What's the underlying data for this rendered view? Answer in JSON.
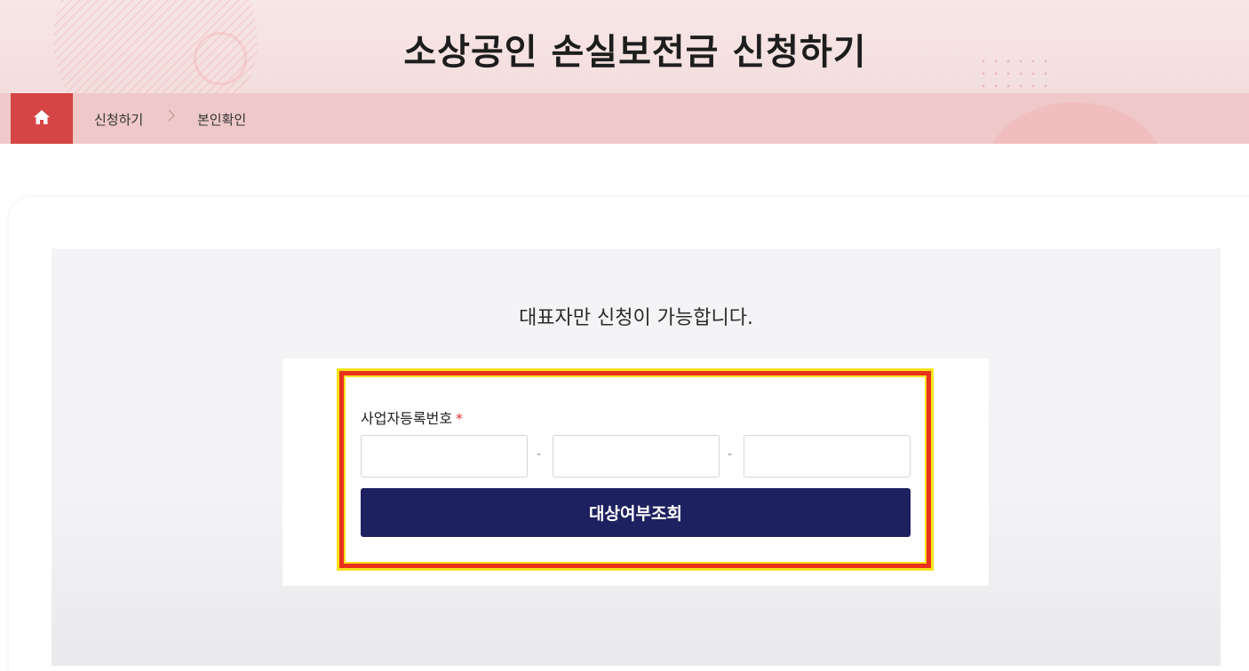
{
  "header": {
    "title": "소상공인 손실보전금 신청하기"
  },
  "breadcrumb": {
    "items": [
      "신청하기",
      "본인확인"
    ],
    "separator": ">"
  },
  "main": {
    "notice": "대표자만 신청이 가능합니다.",
    "form": {
      "field_label": "사업자등록번호",
      "required_mark": "*",
      "inputs": [
        {
          "value": "",
          "placeholder": ""
        },
        {
          "value": "",
          "placeholder": ""
        },
        {
          "value": "",
          "placeholder": ""
        }
      ],
      "dash": "-",
      "submit_label": "대상여부조회"
    }
  },
  "colors": {
    "brand_red": "#d64545",
    "button_navy": "#1e2160",
    "highlight_red": "#e8321e",
    "highlight_yellow": "#f7e21b"
  },
  "icons": {
    "home": "home-icon"
  }
}
